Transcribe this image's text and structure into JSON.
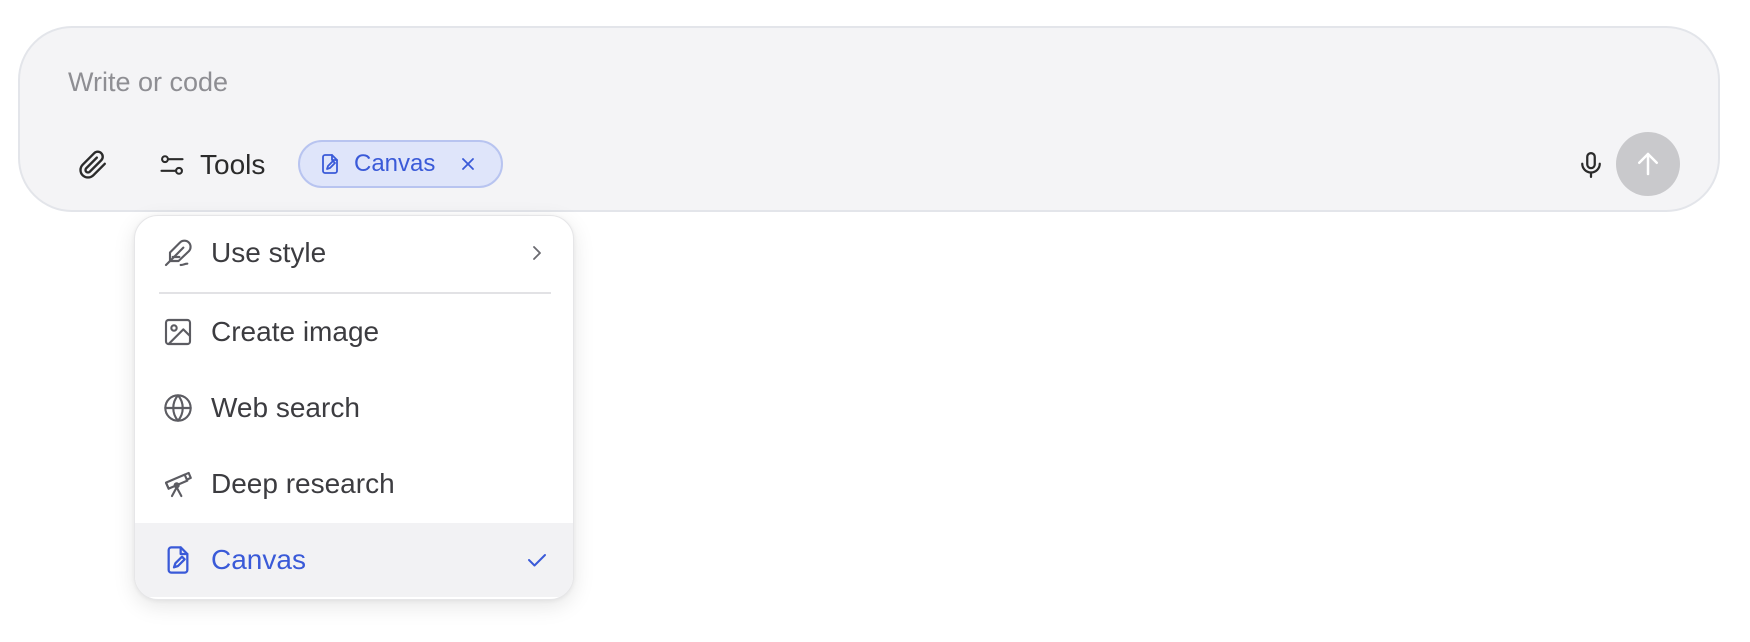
{
  "composer": {
    "placeholder": "Write or code",
    "tools_label": "Tools",
    "chip": {
      "label": "Canvas",
      "color": "#3a5ad8"
    }
  },
  "menu": {
    "items": [
      {
        "label": "Use style",
        "icon": "feather-pen-icon",
        "has_submenu": true
      },
      {
        "label": "Create image",
        "icon": "image-icon"
      },
      {
        "label": "Web search",
        "icon": "globe-icon"
      },
      {
        "label": "Deep research",
        "icon": "telescope-icon"
      },
      {
        "label": "Canvas",
        "icon": "canvas-document-icon",
        "selected": true
      }
    ]
  },
  "colors": {
    "accent": "#3a5ad8",
    "composer_bg": "#f4f4f6",
    "send_disabled": "#c9c9cc"
  }
}
